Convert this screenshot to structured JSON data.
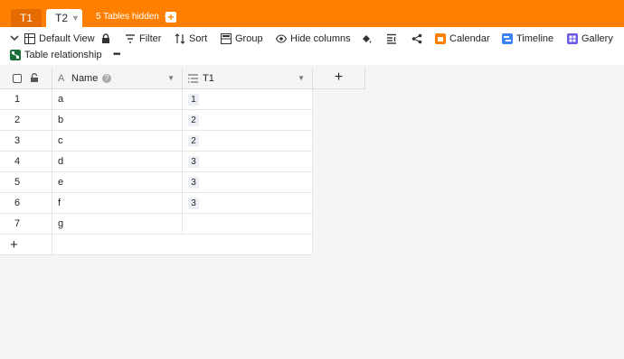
{
  "tabs": {
    "t1_label": "T1",
    "t2_label": "T2",
    "hidden_label": "5 Tables hidden"
  },
  "toolbar": {
    "view_label": "Default View",
    "filter_label": "Filter",
    "sort_label": "Sort",
    "group_label": "Group",
    "hide_columns_label": "Hide columns",
    "calendar_label": "Calendar",
    "timeline_label": "Timeline",
    "gallery_label": "Gallery",
    "table_relationship_label": "Table relationship",
    "more_label": "•••"
  },
  "grid": {
    "columns": {
      "name": "Name",
      "t1": "T1"
    },
    "rows": [
      {
        "num": "1",
        "name": "a",
        "t1": "1"
      },
      {
        "num": "2",
        "name": "b",
        "t1": "2"
      },
      {
        "num": "3",
        "name": "c",
        "t1": "2"
      },
      {
        "num": "4",
        "name": "d",
        "t1": "3"
      },
      {
        "num": "5",
        "name": "e",
        "t1": "3"
      },
      {
        "num": "6",
        "name": "f",
        "t1": "3"
      },
      {
        "num": "7",
        "name": "g",
        "t1": ""
      }
    ]
  },
  "colors": {
    "brand": "#ff8000",
    "tab_inactive": "#e56a00",
    "calendar": "#ff8000",
    "timeline": "#3b82f6",
    "gallery": "#6d5ce7"
  }
}
